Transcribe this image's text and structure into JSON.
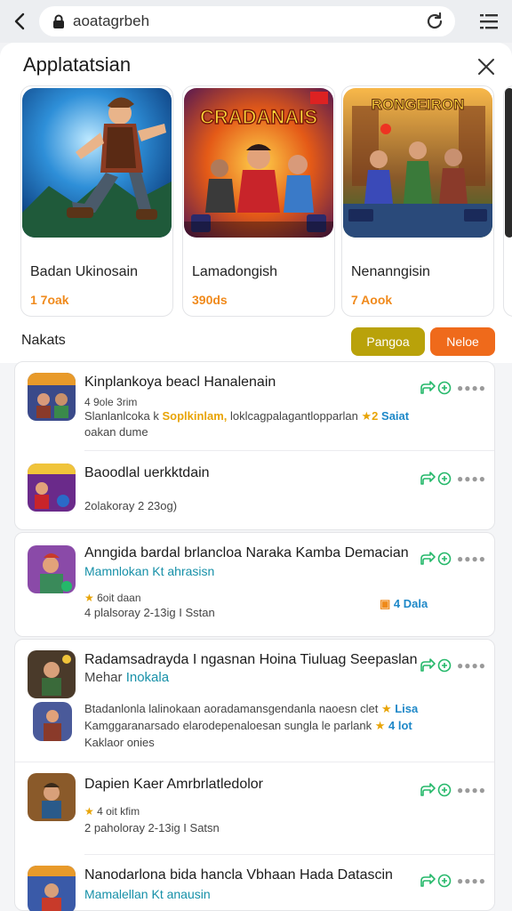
{
  "browser": {
    "url": "aoatagrbeh"
  },
  "sheet": {
    "title": "Applatatsian"
  },
  "carousel": [
    {
      "name": "Badan Ukinosain",
      "sub": "1 7oak"
    },
    {
      "name": "Lamadongish",
      "sub": "390ds",
      "art_text": "CRADANAIS"
    },
    {
      "name": "Nenanngisin",
      "sub": "7 Aook",
      "art_text": "RONGEIRON"
    }
  ],
  "section": {
    "label": "Nakats",
    "pill_a": "Pangoa",
    "pill_b": "Neloe"
  },
  "list": [
    {
      "title": "Kinplankoya beacl Hanalenain",
      "line1": "4 9ole 3rim",
      "line2a": "Slanlanlcoka k",
      "line2b": "Soplkinlam,",
      "line2c": "loklcagpalagantlopparlan",
      "line2d": "2",
      "line2e": "Saiat",
      "line3": "oakan dume"
    },
    {
      "title": "Baoodlal uerkktdain",
      "line1": "2olakoray 2 23og)"
    },
    {
      "title": "Anngida bardal brlancloa Naraka Kamba Demacian",
      "line1": "Mamnlokan Kt ahrasisn",
      "line2": "6oit daan",
      "line3": "4 plalsoray 2-13ig I Sstan",
      "tag": "4 Dala"
    },
    {
      "title": "Radamsadrayda I ngasnan Hoina Tiuluag Seepaslan",
      "subtitle_a": "Mehar",
      "subtitle_b": "Inokala",
      "line1": "Btadanlonla lalinokaan aoradamansgendanla naoesn clet",
      "line1_tag": "Lisa",
      "line2": "Kamggaranarsado elarodepenaloesan sungla le parlank",
      "line2_tag": "4 lot",
      "line3": "Kaklaor onies"
    },
    {
      "title": "Dapien Kaer Amrbrlatledolor",
      "line1": "4 oit kfim",
      "line2": "2 paholoray 2-13ig I Satsn"
    },
    {
      "title": "Nanodarlona bida hancla Vbhaan Hada Datascin",
      "line1": "Mamalellan Kt anausin"
    }
  ],
  "colors": {
    "orange": "#ef6a1b",
    "olive": "#b9a20a",
    "green_icon": "#25b86a",
    "teal_text": "#1690a8"
  }
}
